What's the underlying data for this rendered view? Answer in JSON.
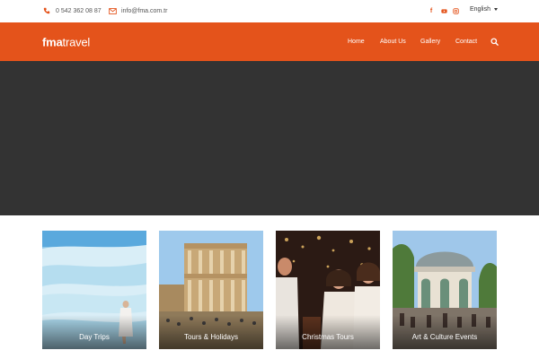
{
  "topbar": {
    "phone": "0 542 362 08 87",
    "email": "info@fma.com.tr",
    "phone_icon": "phone-icon",
    "email_icon": "envelope-icon",
    "social": [
      "facebook-icon",
      "youtube-icon",
      "instagram-icon"
    ],
    "language": "English"
  },
  "header": {
    "logo_bold": "fma",
    "logo_light": "travel",
    "menu": [
      "Home",
      "About Us",
      "Gallery",
      "Contact"
    ],
    "search_icon": "search-icon"
  },
  "colors": {
    "brand": "#e4531b",
    "hero": "#333333"
  },
  "cards": [
    {
      "label": "Day Trips",
      "image": "pamukkale-travertines"
    },
    {
      "label": "Tours & Holidays",
      "image": "ephesus-library"
    },
    {
      "label": "Christmas Tours",
      "image": "christmas-celebration"
    },
    {
      "label": "Art & Culture Events",
      "image": "ottoman-fountain"
    }
  ]
}
